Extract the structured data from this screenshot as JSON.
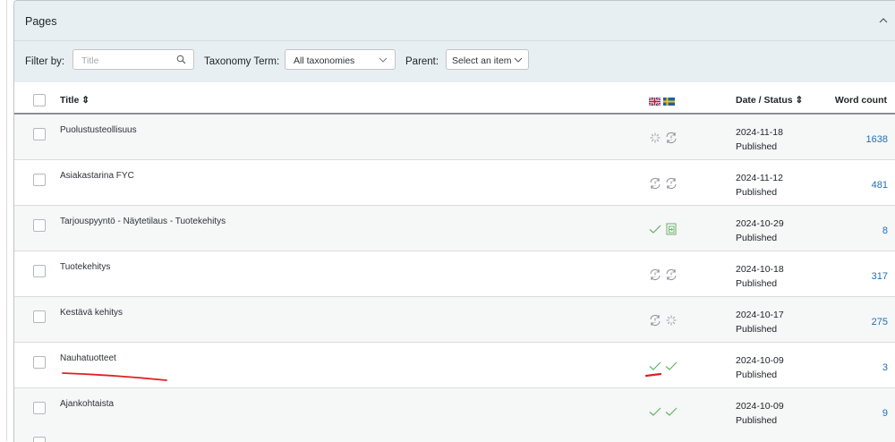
{
  "panel": {
    "title": "Pages"
  },
  "filters": {
    "filter_by_label": "Filter by:",
    "title_placeholder": "Title",
    "taxonomy_label": "Taxonomy Term:",
    "taxonomy_value": "All taxonomies",
    "parent_label": "Parent:",
    "parent_value": "Select an item"
  },
  "table": {
    "headers": {
      "title": "Title ⇕",
      "date_status": "Date / Status ⇕",
      "word_count": "Word count"
    },
    "languages": [
      "en",
      "sv"
    ],
    "rows": [
      {
        "title": "Puolustusteollisuus",
        "date": "2024-11-18",
        "status": "Published",
        "word_count": "1638",
        "translations": [
          "in-progress-icon",
          "needs-update-icon"
        ]
      },
      {
        "title": "Asiakastarina FYC",
        "date": "2024-11-12",
        "status": "Published",
        "word_count": "481",
        "translations": [
          "needs-update-icon",
          "needs-update-icon"
        ]
      },
      {
        "title": "Tarjouspyyntö - Näytetilaus - Tuotekehitys",
        "date": "2024-10-29",
        "status": "Published",
        "word_count": "8",
        "translations": [
          "check-icon",
          "duplicate-icon"
        ]
      },
      {
        "title": "Tuotekehitys",
        "date": "2024-10-18",
        "status": "Published",
        "word_count": "317",
        "translations": [
          "needs-update-icon",
          "needs-update-icon"
        ]
      },
      {
        "title": "Kestävä kehitys",
        "date": "2024-10-17",
        "status": "Published",
        "word_count": "275",
        "translations": [
          "needs-update-icon",
          "in-progress-icon"
        ]
      },
      {
        "title": "Nauhatuotteet",
        "date": "2024-10-09",
        "status": "Published",
        "word_count": "3",
        "translations": [
          "check-icon",
          "check-icon"
        ]
      },
      {
        "title": "Ajankohtaista",
        "date": "2024-10-09",
        "status": "Published",
        "word_count": "9",
        "translations": [
          "check-icon",
          "check-icon"
        ]
      }
    ]
  },
  "colors": {
    "accent": "#2271b1",
    "check": "#68b368",
    "annotation": "#e02020"
  }
}
